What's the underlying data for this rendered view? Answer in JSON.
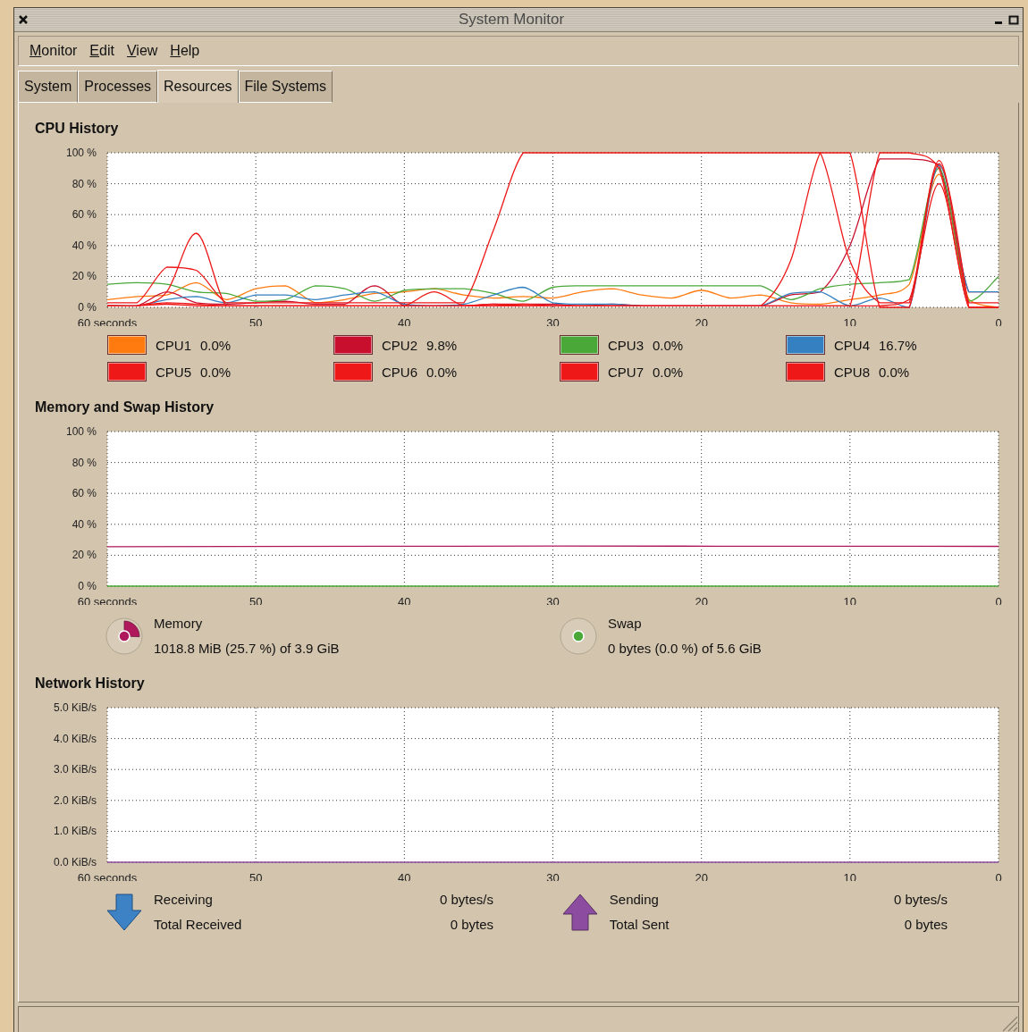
{
  "window": {
    "title": "System Monitor"
  },
  "menu": [
    "Monitor",
    "Edit",
    "View",
    "Help"
  ],
  "tabs": [
    {
      "label": "System",
      "selected": false
    },
    {
      "label": "Processes",
      "selected": false
    },
    {
      "label": "Resources",
      "selected": true
    },
    {
      "label": "File Systems",
      "selected": false
    }
  ],
  "cpu_history": {
    "title": "CPU History",
    "chart_data": {
      "type": "line",
      "grid": true,
      "xlim": [
        60,
        0
      ],
      "ylim": [
        0,
        100
      ],
      "xticks": [
        {
          "value": 60,
          "label": "60 seconds"
        },
        50,
        40,
        30,
        20,
        10,
        0
      ],
      "yticks": [
        {
          "value": 0,
          "label": "0 %"
        },
        {
          "value": 20,
          "label": "20 %"
        },
        {
          "value": 40,
          "label": "40 %"
        },
        {
          "value": 60,
          "label": "60 %"
        },
        {
          "value": 80,
          "label": "80 %"
        },
        {
          "value": 100,
          "label": "100 %"
        }
      ],
      "x": [
        60,
        58,
        56,
        54,
        52,
        50,
        48,
        46,
        44,
        42,
        40,
        38,
        36,
        34,
        32,
        30,
        28,
        26,
        24,
        22,
        20,
        18,
        16,
        14,
        12,
        10,
        8,
        6,
        4,
        2,
        0
      ],
      "series": [
        {
          "name": "CPU1",
          "color": "#ff7b10",
          "values": [
            5,
            7,
            8,
            16,
            5,
            12,
            14,
            3,
            5,
            9,
            10,
            12,
            8,
            6,
            7,
            6,
            10,
            12,
            8,
            6,
            11,
            6,
            8,
            3,
            2,
            5,
            8,
            15,
            86,
            5,
            0
          ]
        },
        {
          "name": "CPU2",
          "color": "#c8102e",
          "values": [
            1,
            1,
            10,
            3,
            2,
            3,
            4,
            2,
            2,
            14,
            1,
            1,
            1,
            2,
            2,
            2,
            1,
            2,
            1,
            1,
            1,
            1,
            1,
            8,
            10,
            40,
            96,
            96,
            92,
            10,
            10
          ]
        },
        {
          "name": "CPU3",
          "color": "#4aa838",
          "values": [
            15,
            16,
            15,
            10,
            9,
            4,
            5,
            14,
            12,
            4,
            11,
            12,
            12,
            9,
            4,
            13,
            14,
            14,
            14,
            14,
            14,
            14,
            14,
            5,
            12,
            15,
            16,
            18,
            90,
            4,
            20
          ]
        },
        {
          "name": "CPU4",
          "color": "#3480c0",
          "values": [
            1,
            1,
            5,
            7,
            3,
            8,
            8,
            5,
            8,
            10,
            2,
            1,
            2,
            8,
            13,
            3,
            2,
            2,
            1,
            1,
            1,
            1,
            1,
            9,
            10,
            1,
            6,
            0,
            92,
            10,
            10
          ]
        },
        {
          "name": "CPU5",
          "color": "#ee1818",
          "values": [
            3,
            3,
            26,
            24,
            3,
            3,
            3,
            3,
            3,
            3,
            3,
            3,
            3,
            50,
            100,
            100,
            100,
            100,
            100,
            100,
            100,
            100,
            100,
            100,
            100,
            30,
            3,
            3,
            95,
            3,
            3
          ]
        },
        {
          "name": "CPU6",
          "color": "#ee1818",
          "values": [
            1,
            1,
            10,
            48,
            1,
            1,
            1,
            1,
            1,
            1,
            1,
            10,
            1,
            1,
            2,
            1,
            1,
            1,
            1,
            1,
            1,
            1,
            1,
            30,
            100,
            100,
            0,
            0,
            93,
            0,
            null
          ]
        },
        {
          "name": "CPU7",
          "color": "#ee1818",
          "values": [
            null,
            1,
            3,
            2,
            1,
            1,
            1,
            1,
            1,
            1,
            1,
            1,
            1,
            2,
            1,
            1,
            1,
            1,
            1,
            1,
            1,
            1,
            1,
            1,
            1,
            1,
            100,
            100,
            90,
            0,
            0
          ]
        },
        {
          "name": "CPU8",
          "color": "#ee1818",
          "values": [
            1,
            1,
            2,
            1,
            1,
            1,
            1,
            1,
            1,
            1,
            1,
            1,
            1,
            1,
            1,
            1,
            1,
            1,
            1,
            1,
            1,
            1,
            1,
            1,
            1,
            1,
            1,
            5,
            80,
            0,
            0
          ]
        }
      ]
    },
    "legend": [
      {
        "reading": "0.0%"
      },
      {
        "reading": "9.8%"
      },
      {
        "reading": "0.0%"
      },
      {
        "reading": "16.7%"
      },
      {
        "reading": "0.0%"
      },
      {
        "reading": "0.0%"
      },
      {
        "reading": "0.0%"
      },
      {
        "reading": "0.0%"
      }
    ]
  },
  "memory_history": {
    "title": "Memory and Swap History",
    "chart_data": {
      "type": "line",
      "grid": true,
      "xlim": [
        60,
        0
      ],
      "ylim": [
        0,
        100
      ],
      "xticks": [
        {
          "value": 60,
          "label": "60 seconds"
        },
        50,
        40,
        30,
        20,
        10,
        0
      ],
      "yticks": [
        {
          "value": 0,
          "label": "0 %"
        },
        {
          "value": 20,
          "label": "20 %"
        },
        {
          "value": 40,
          "label": "40 %"
        },
        {
          "value": 60,
          "label": "60 %"
        },
        {
          "value": 80,
          "label": "80 %"
        },
        {
          "value": 100,
          "label": "100 %"
        }
      ],
      "x": [
        60,
        30,
        0
      ],
      "series": [
        {
          "name": "Memory",
          "color": "#b0185c",
          "values": [
            25.5,
            25.9,
            25.7
          ]
        },
        {
          "name": "Swap",
          "color": "#4aa838",
          "values": [
            0,
            0,
            0
          ]
        }
      ]
    },
    "meters": [
      {
        "reading": "1018.8 MiB (25.7 %) of 3.9 GiB"
      },
      {
        "reading": "0 bytes (0.0 %) of 5.6 GiB"
      }
    ]
  },
  "network_history": {
    "title": "Network History",
    "chart_data": {
      "type": "line",
      "grid": true,
      "xlim": [
        60,
        0
      ],
      "ylim": [
        0,
        5
      ],
      "xticks": [
        {
          "value": 60,
          "label": "60 seconds"
        },
        50,
        40,
        30,
        20,
        10,
        0
      ],
      "yticks": [
        {
          "value": 0,
          "label": "0.0 KiB/s"
        },
        {
          "value": 1,
          "label": "1.0 KiB/s"
        },
        {
          "value": 2,
          "label": "2.0 KiB/s"
        },
        {
          "value": 3,
          "label": "3.0 KiB/s"
        },
        {
          "value": 4,
          "label": "4.0 KiB/s"
        },
        {
          "value": 5,
          "label": "5.0 KiB/s"
        }
      ],
      "x": [
        60,
        0
      ],
      "series": [
        {
          "name": "Receiving",
          "color": "#3d82c4",
          "values": [
            null,
            null
          ]
        },
        {
          "name": "Sending",
          "color": "#8c4ca0",
          "values": [
            0,
            0
          ]
        }
      ]
    },
    "stats": [
      {
        "kind": "incoming",
        "rate": "0 bytes/s",
        "total_label": "Total Received",
        "total": "0 bytes"
      },
      {
        "kind": "outgoing",
        "rate": "0 bytes/s",
        "total_label": "Total Sent",
        "total": "0 bytes"
      }
    ]
  }
}
